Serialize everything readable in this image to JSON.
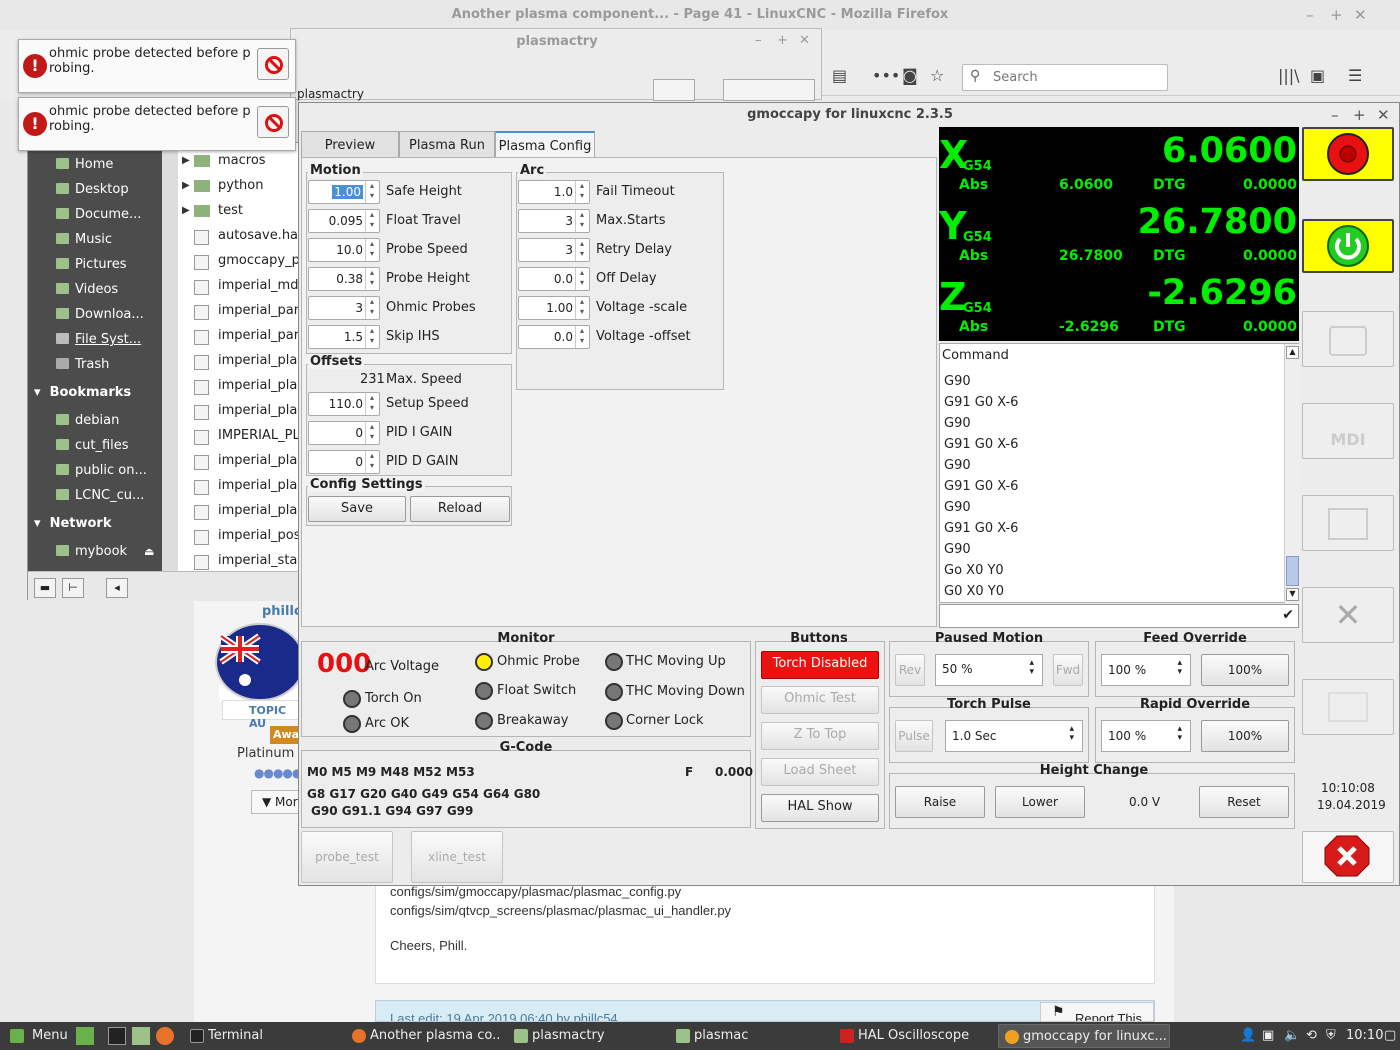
{
  "firefox": {
    "title": "Another plasma component... - Page 41 - LinuxCNC - Mozilla Firefox",
    "search_placeholder": "Search"
  },
  "page": {
    "phill": "phillc",
    "topic": "TOPIC AU",
    "away": "Away",
    "platinum": "Platinum E",
    "more": "Mor",
    "lines": [
      "configs/sim/gmoccapy/plasmac/plasmac_config.py",
      "configs/sim/qtvcp_screens/plasmac/plasmac_ui_handler.py",
      "Cheers, Phill."
    ],
    "last_edit": "Last edit: 19 Apr 2019 06:40 by phillc54",
    "report": "Report This"
  },
  "plasmactry": {
    "title": "plasmactry",
    "path": "plasmactry"
  },
  "notifications": [
    {
      "text": "ohmic probe detected before p robing."
    },
    {
      "text": "ohmic probe detected before p robing."
    }
  ],
  "filemanager": {
    "places": [
      "Home",
      "Desktop",
      "Docume...",
      "Music",
      "Pictures",
      "Videos",
      "Downloa...",
      "File Syst...",
      "Trash"
    ],
    "bookmarks_label": "Bookmarks",
    "bookmarks": [
      "debian",
      "cut_files",
      "public on...",
      "LCNC_cu..."
    ],
    "network_label": "Network",
    "network": [
      "mybook"
    ],
    "folders": [
      "macros",
      "python",
      "test"
    ],
    "files": [
      "autosave.hals",
      "gmoccapy_po:",
      "imperial_mdi_",
      "imperial_para",
      "imperial_para",
      "imperial_plasr",
      "imperial_plasr",
      "imperial_plasr",
      "IMPERIAL_PLA",
      "imperial_plasr",
      "imperial_plasr",
      "imperial_plasr",
      "imperial_posit",
      "imperial_start"
    ]
  },
  "gmoccapy": {
    "title": "gmoccapy for linuxcnc  2.3.5",
    "tabs": [
      "Preview",
      "Plasma Run",
      "Plasma Config"
    ],
    "motion": {
      "label": "Motion",
      "rows": [
        {
          "v": "1.00",
          "l": "Safe Height"
        },
        {
          "v": "0.095",
          "l": "Float Travel"
        },
        {
          "v": "10.0",
          "l": "Probe Speed"
        },
        {
          "v": "0.38",
          "l": "Probe Height"
        },
        {
          "v": "3",
          "l": "Ohmic Probes"
        },
        {
          "v": "1.5",
          "l": "Skip IHS"
        }
      ]
    },
    "arc": {
      "label": "Arc",
      "rows": [
        {
          "v": "1.0",
          "l": "Fail Timeout"
        },
        {
          "v": "3",
          "l": "Max.Starts"
        },
        {
          "v": "3",
          "l": "Retry Delay"
        },
        {
          "v": "0.0",
          "l": "Off Delay"
        },
        {
          "v": "1.00",
          "l": "Voltage -scale"
        },
        {
          "v": "0.0",
          "l": "Voltage -offset"
        }
      ]
    },
    "offsets": {
      "label": "Offsets",
      "max_speed_val": "231",
      "max_speed_lbl": "Max. Speed",
      "rows": [
        {
          "v": "110.0",
          "l": "Setup Speed"
        },
        {
          "v": "0",
          "l": "PID I GAIN"
        },
        {
          "v": "0",
          "l": "PID D GAIN"
        }
      ]
    },
    "config": {
      "label": "Config Settings",
      "save": "Save",
      "reload": "Reload"
    },
    "dro": [
      {
        "axis": "X",
        "cs": "G54",
        "value": "6.0600",
        "abs_lbl": "Abs",
        "abs": "6.0600",
        "dtg_lbl": "DTG",
        "dtg": "0.0000"
      },
      {
        "axis": "Y",
        "cs": "G54",
        "value": "26.7800",
        "abs_lbl": "Abs",
        "abs": "26.7800",
        "dtg_lbl": "DTG",
        "dtg": "0.0000"
      },
      {
        "axis": "Z",
        "cs": "G54",
        "value": "-2.6296",
        "abs_lbl": "Abs",
        "abs": "-2.6296",
        "dtg_lbl": "DTG",
        "dtg": "0.0000"
      }
    ],
    "command": {
      "header": "Command",
      "lines": [
        "G90",
        "G91 G0 X-6",
        "G90",
        "G91 G0 X-6",
        "G90",
        "G91 G0 X-6",
        "G90",
        "G91 G0 X-6",
        "G90",
        "Go X0 Y0",
        "G0 X0 Y0"
      ]
    },
    "monitor": {
      "label": "Monitor",
      "arc_voltage_val": "000",
      "arc_voltage": "Arc Voltage",
      "torch_on": "Torch On",
      "arc_ok": "Arc OK",
      "ohmic_probe": "Ohmic Probe",
      "float_switch": "Float Switch",
      "breakaway": "Breakaway",
      "thc_up": "THC Moving Up",
      "thc_down": "THC Moving Down",
      "corner_lock": "Corner Lock"
    },
    "buttons": {
      "label": "Buttons",
      "torch": "Torch Disabled",
      "ohmic": "Ohmic Test",
      "ztop": "Z To Top",
      "load": "Load Sheet",
      "hal": "HAL Show"
    },
    "gcode": {
      "label": "G-Code",
      "line1": "M0 M5 M9 M48 M52 M53",
      "f_lbl": "F",
      "f_val": "0.000",
      "line2": "G8 G17 G20 G40 G49 G54 G64 G80",
      "line3": "G90 G91.1 G94 G97 G99"
    },
    "paused": {
      "label": "Paused Motion",
      "rev": "Rev",
      "val": "50 %",
      "fwd": "Fwd"
    },
    "torch_pulse": {
      "label": "Torch Pulse",
      "btn": "Pulse",
      "val": "1.0 Sec"
    },
    "feed": {
      "label": "Feed Override",
      "val": "100 %",
      "btn": "100%"
    },
    "rapid": {
      "label": "Rapid Override",
      "val": "100 %",
      "btn": "100%"
    },
    "height": {
      "label": "Height Change",
      "raise": "Raise",
      "lower": "Lower",
      "val": "0.0 V",
      "reset": "Reset"
    },
    "probe_test": "probe_test",
    "xline_test": "xline_test",
    "time": "10:10:08",
    "date": "19.04.2019"
  },
  "taskbar": {
    "menu": "Menu",
    "items": [
      "Terminal",
      "Another plasma co...",
      "plasmactry",
      "plasmac",
      "HAL Oscilloscope",
      "gmoccapy for linuxc..."
    ],
    "clock": "10:10"
  },
  "colors": {
    "dro_green": "#00ee00",
    "estop_yellow": "#ffff00",
    "torch_red": "#ee1111"
  }
}
